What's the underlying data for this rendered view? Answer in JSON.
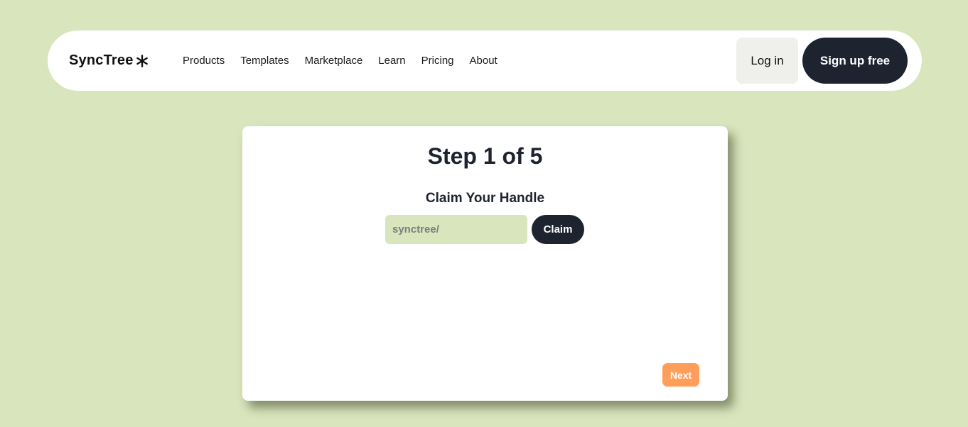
{
  "brand": {
    "name": "SyncTree",
    "icon": "asterisk-logo-icon"
  },
  "nav": {
    "links": [
      "Products",
      "Templates",
      "Marketplace",
      "Learn",
      "Pricing",
      "About"
    ],
    "login_label": "Log in",
    "signup_label": "Sign up free"
  },
  "wizard": {
    "step_title": "Step 1 of 5",
    "section_title": "Claim Your Handle",
    "handle_placeholder": "synctree/",
    "handle_value": "",
    "claim_label": "Claim",
    "next_label": "Next"
  },
  "colors": {
    "background": "#d9e5bc",
    "dark": "#1e2330",
    "accent": "#ff9e5a"
  }
}
